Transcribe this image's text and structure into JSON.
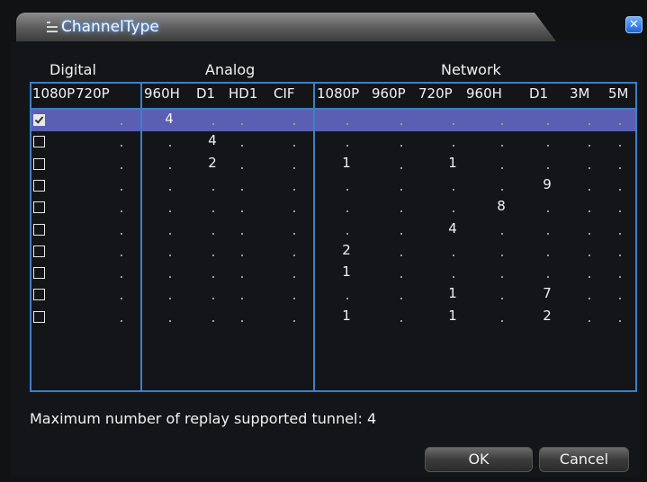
{
  "dialog": {
    "title": "ChannelType",
    "close_glyph": "✕"
  },
  "groups": {
    "digital": "Digital",
    "analog": "Analog",
    "network": "Network"
  },
  "columns": [
    "1080P",
    "720P",
    "960H",
    "D1",
    "HD1",
    "CIF",
    "1080P",
    "960P",
    "720P",
    "960H",
    "D1",
    "3M",
    "5M"
  ],
  "rows": [
    {
      "checked": true,
      "values": [
        "",
        "",
        "4",
        "",
        "",
        "",
        "",
        "",
        "",
        "",
        "",
        "",
        ""
      ]
    },
    {
      "checked": false,
      "values": [
        "",
        "",
        "",
        "4",
        "",
        "",
        "",
        "",
        "",
        "",
        "",
        "",
        ""
      ]
    },
    {
      "checked": false,
      "values": [
        "",
        "",
        "",
        "2",
        "",
        "",
        "1",
        "",
        "1",
        "",
        "",
        "",
        ""
      ]
    },
    {
      "checked": false,
      "values": [
        "",
        "",
        "",
        "",
        "",
        "",
        "",
        "",
        "",
        "",
        "9",
        "",
        ""
      ]
    },
    {
      "checked": false,
      "values": [
        "",
        "",
        "",
        "",
        "",
        "",
        "",
        "",
        "",
        "8",
        "",
        "",
        ""
      ]
    },
    {
      "checked": false,
      "values": [
        "",
        "",
        "",
        "",
        "",
        "",
        "",
        "",
        "4",
        "",
        "",
        "",
        ""
      ]
    },
    {
      "checked": false,
      "values": [
        "",
        "",
        "",
        "",
        "",
        "",
        "2",
        "",
        "",
        "",
        "",
        "",
        ""
      ]
    },
    {
      "checked": false,
      "values": [
        "",
        "",
        "",
        "",
        "",
        "",
        "1",
        "",
        "",
        "",
        "",
        "",
        ""
      ]
    },
    {
      "checked": false,
      "values": [
        "",
        "",
        "",
        "",
        "",
        "",
        "",
        "",
        "1",
        "",
        "7",
        "",
        ""
      ]
    },
    {
      "checked": false,
      "values": [
        "",
        "",
        "",
        "",
        "",
        "",
        "1",
        "",
        "1",
        "",
        "2",
        "",
        ""
      ]
    }
  ],
  "footer": {
    "replay_text": "Maximum number of replay supported tunnel: 4"
  },
  "buttons": {
    "ok": "OK",
    "cancel": "Cancel"
  },
  "colors": {
    "selected_row": "#5a5fb4",
    "grid_lines": "#3d80c4",
    "title_glow": "#7ab0ff"
  }
}
